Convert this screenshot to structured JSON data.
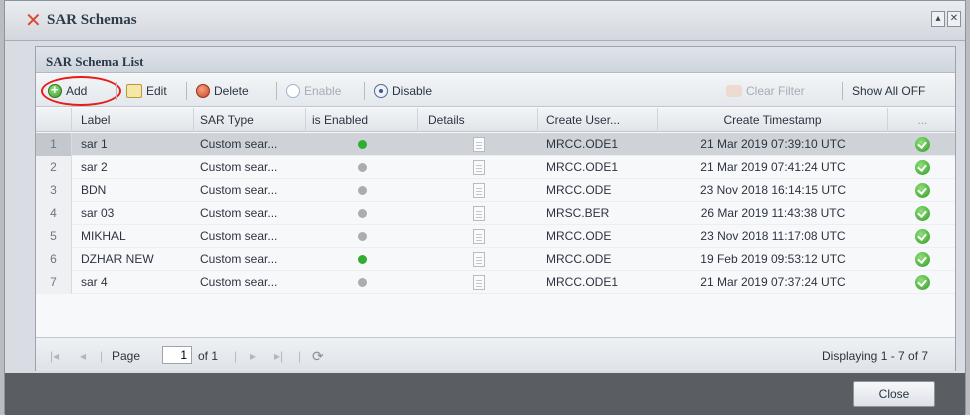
{
  "window": {
    "title": "SAR Schemas",
    "buttons": [
      "min",
      "close"
    ]
  },
  "panel": {
    "title": "SAR Schema List"
  },
  "toolbar": {
    "add": "Add",
    "edit": "Edit",
    "delete": "Delete",
    "enable": "Enable",
    "disable": "Disable",
    "clear_filter": "Clear Filter",
    "show_all": "Show All OFF"
  },
  "columns": [
    "Label",
    "SAR Type",
    "is Enabled",
    "Details",
    "Create User...",
    "Create Timestamp",
    "..."
  ],
  "rows": [
    {
      "num": "1",
      "label": "sar 1",
      "type": "Custom sear...",
      "enabled": true,
      "user": "MRCC.ODE1",
      "timestamp": "21 Mar 2019 07:39:10 UTC",
      "selected": true
    },
    {
      "num": "2",
      "label": "sar 2",
      "type": "Custom sear...",
      "enabled": false,
      "user": "MRCC.ODE1",
      "timestamp": "21 Mar 2019 07:41:24 UTC",
      "selected": false
    },
    {
      "num": "3",
      "label": "BDN",
      "type": "Custom sear...",
      "enabled": false,
      "user": "MRCC.ODE",
      "timestamp": "23 Nov 2018 16:14:15 UTC",
      "selected": false
    },
    {
      "num": "4",
      "label": "sar 03",
      "type": "Custom sear...",
      "enabled": false,
      "user": "MRSC.BER",
      "timestamp": "26 Mar 2019 11:43:38 UTC",
      "selected": false
    },
    {
      "num": "5",
      "label": "MIKHAL",
      "type": "Custom sear...",
      "enabled": false,
      "user": "MRCC.ODE",
      "timestamp": "23 Nov 2018 11:17:08 UTC",
      "selected": false
    },
    {
      "num": "6",
      "label": "DZHAR NEW",
      "type": "Custom sear...",
      "enabled": true,
      "user": "MRCC.ODE",
      "timestamp": "19 Feb 2019 09:53:12 UTC",
      "selected": false
    },
    {
      "num": "7",
      "label": "sar 4",
      "type": "Custom sear...",
      "enabled": false,
      "user": "MRCC.ODE1",
      "timestamp": "21 Mar 2019 07:37:24 UTC",
      "selected": false
    }
  ],
  "pager": {
    "page_label": "Page",
    "page_value": "1",
    "of_label": "of 1",
    "displaying": "Displaying 1 - 7 of 7"
  },
  "footer": {
    "close": "Close"
  },
  "colors": {
    "enabled_dot": "#2fae2f",
    "disabled_dot": "#a9adb2",
    "selected_row": "#cfd3d8",
    "annotation_circle": "#e81a1a"
  },
  "icons": {
    "add": "add-circle-icon",
    "edit": "edit-icon",
    "delete": "delete-icon",
    "enable": "enable-icon",
    "disable": "disable-icon",
    "clear_filter": "clear-filter-icon",
    "refresh": "refresh-icon"
  }
}
